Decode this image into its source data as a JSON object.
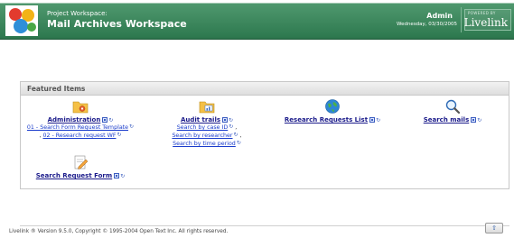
{
  "header": {
    "workspace_label": "Project Workspace:",
    "workspace_title": "Mail Archives Workspace",
    "user_name": "Admin",
    "date": "Wednesday, 03/30/2005",
    "powered_by": "POWERED BY",
    "brand": "Livelink"
  },
  "featured": {
    "heading": "Featured Items",
    "items": [
      {
        "title": "Administration",
        "links": [
          "01 - Search Form Request Template",
          "02 - Research request WF"
        ]
      },
      {
        "title": "Audit trails",
        "links": [
          "Search by case ID",
          "Search by researcher",
          "Search by time period"
        ]
      },
      {
        "title": "Research Requests List",
        "links": []
      },
      {
        "title": "Search mails",
        "links": []
      },
      {
        "title": "Search Request Form",
        "links": []
      }
    ]
  },
  "footer": {
    "copyright": "Livelink ® Version 9.5.0, Copyright © 1995-2004 Open Text Inc. All rights reserved.",
    "up_arrow": "⇧"
  },
  "colors": {
    "header_green": "#2f7a50",
    "link_blue": "#1a3ccc",
    "title_blue": "#1a1a8a"
  },
  "icons": [
    "livelink-logo-icon",
    "folder-gear-icon",
    "folder-chart-icon",
    "globe-icon",
    "magnifier-icon",
    "form-pencil-icon",
    "menu-icon",
    "arrow-icon"
  ]
}
